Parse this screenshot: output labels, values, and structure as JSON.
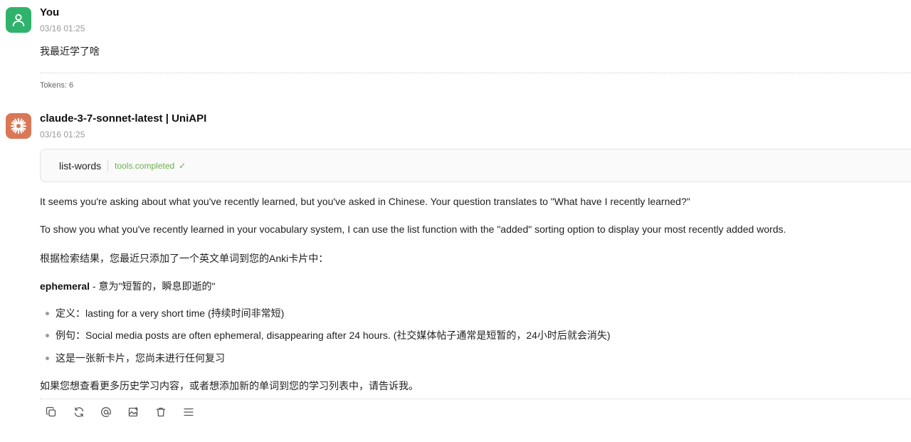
{
  "user": {
    "name": "You",
    "time": "03/16 01:25",
    "message": "我最近学了啥",
    "tokens": "Tokens: 6"
  },
  "assistant": {
    "name": "claude-3-7-sonnet-latest | UniAPI",
    "time": "03/16 01:25",
    "tool": {
      "name": "list-words",
      "status": "tools.completed",
      "check": "✓"
    },
    "paragraphs": {
      "p1": "It seems you're asking about what you've recently learned, but you've asked in Chinese. Your question translates to \"What have I recently learned?\"",
      "p2": "To show you what you've recently learned in your vocabulary system, I can use the list function with the \"added\" sorting option to display your most recently added words.",
      "p3": "根据检索结果，您最近只添加了一个英文单词到您的Anki卡片中：",
      "word": "ephemeral",
      "word_meaning": " - 意为\"短暂的，瞬息即逝的\"",
      "p_end": "如果您想查看更多历史学习内容，或者想添加新的单词到您的学习列表中，请告诉我。"
    },
    "bullets": [
      "定义：lasting for a very short time (持续时间非常短)",
      "例句：Social media posts are often ephemeral, disappearing after 24 hours. (社交媒体帖子通常是短暂的，24小时后就会消失)",
      "这是一张新卡片，您尚未进行任何复习"
    ]
  },
  "actions": [
    "copy-icon",
    "regenerate-icon",
    "mention-icon",
    "image-icon",
    "delete-icon",
    "menu-icon"
  ],
  "colors": {
    "user_avatar": "#2fb36c",
    "bot_avatar": "#d97757",
    "tool_status": "#6ab04c"
  }
}
